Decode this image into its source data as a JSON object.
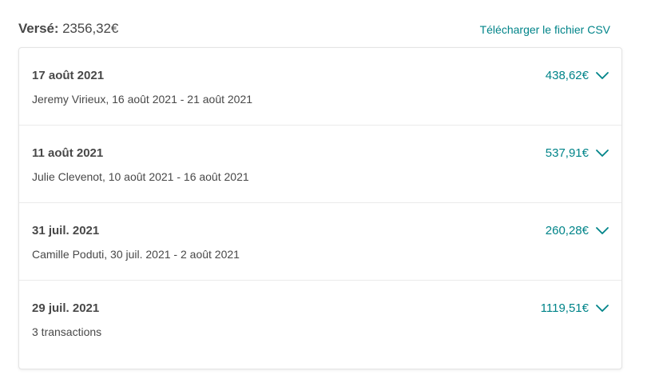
{
  "header": {
    "total_label": "Versé:",
    "total_value": " 2356,32€",
    "csv_link": "Télécharger le fichier CSV"
  },
  "payouts": [
    {
      "date": "17 août 2021",
      "description": "Jeremy Virieux, 16 août 2021 - 21 août 2021",
      "amount": "438,62€"
    },
    {
      "date": "11 août 2021",
      "description": "Julie Clevenot, 10 août 2021 - 16 août 2021",
      "amount": "537,91€"
    },
    {
      "date": "31 juil. 2021",
      "description": "Camille Poduti, 30 juil. 2021 - 2 août 2021",
      "amount": "260,28€"
    },
    {
      "date": "29 juil. 2021",
      "description": "3 transactions",
      "amount": "1119,51€"
    }
  ],
  "colors": {
    "accent": "#008489",
    "text": "#484848",
    "border": "#e4e4e4"
  },
  "icons": {
    "expand": "chevron-down-icon"
  }
}
